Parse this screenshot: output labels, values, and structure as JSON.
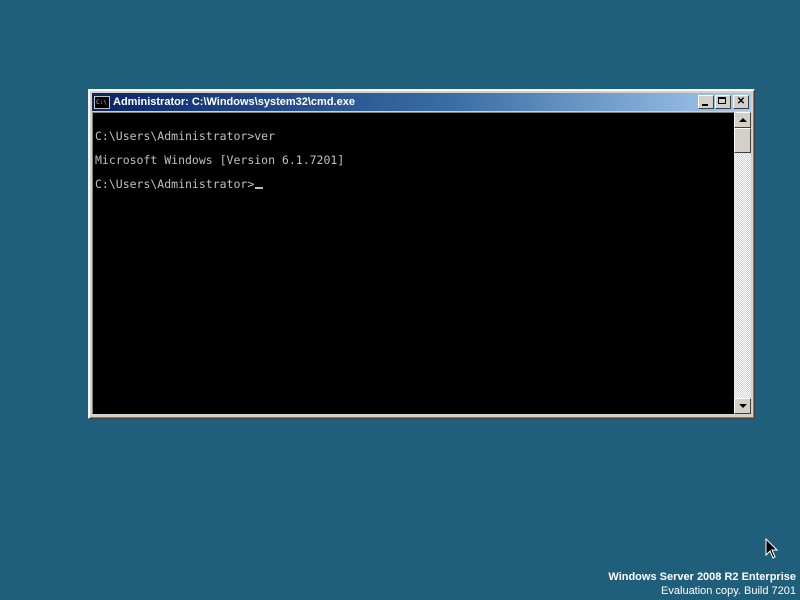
{
  "window": {
    "title": "Administrator: C:\\Windows\\system32\\cmd.exe",
    "icon": "console-icon",
    "icon_text": "C:\\",
    "buttons": {
      "minimize": "minimize-icon",
      "maximize": "maximize-icon",
      "close": "close-icon",
      "close_glyph": "✕"
    }
  },
  "console": {
    "lines": [
      "C:\\Users\\Administrator>ver",
      "Microsoft Windows [Version 6.1.7201]",
      "C:\\Users\\Administrator>"
    ],
    "text_color": "#c0c0c0",
    "background_color": "#000000"
  },
  "desktop": {
    "background_color": "#1f5f7b"
  },
  "watermark": {
    "edition": "Windows Server 2008 R2 Enterprise",
    "evaluation": "Evaluation copy. Build 7201"
  }
}
